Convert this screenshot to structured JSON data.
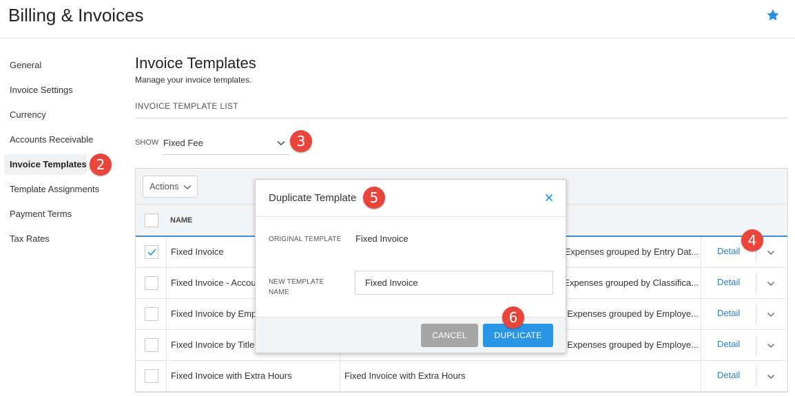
{
  "app": {
    "title": "Billing & Invoices"
  },
  "sidebar": {
    "items": [
      {
        "label": "General"
      },
      {
        "label": "Invoice Settings"
      },
      {
        "label": "Currency"
      },
      {
        "label": "Accounts Receivable"
      },
      {
        "label": "Invoice Templates",
        "active": true
      },
      {
        "label": "Template Assignments"
      },
      {
        "label": "Payment Terms"
      },
      {
        "label": "Tax Rates"
      }
    ]
  },
  "main": {
    "title": "Invoice Templates",
    "subtitle": "Manage your invoice templates.",
    "section_label": "INVOICE TEMPLATE LIST",
    "filter": {
      "label": "SHOW",
      "value": "Fixed Fee"
    },
    "actions_label": "Actions",
    "table": {
      "name_header": "NAME",
      "detail_label": "Detail",
      "rows": [
        {
          "name": "Fixed Invoice",
          "description": "Expenses grouped by Entry Dat...",
          "checked": true
        },
        {
          "name": "Fixed Invoice - Accou",
          "description": "Expenses grouped by Classifica...",
          "checked": false
        },
        {
          "name": "Fixed Invoice by Emp",
          "description": "Expenses grouped by Employe...",
          "checked": false
        },
        {
          "name": "Fixed Invoice by Title",
          "description": "Expenses grouped by Employe...",
          "checked": false
        },
        {
          "name": "Fixed Invoice with Extra Hours",
          "description": "Fixed Invoice with Extra Hours",
          "checked": false
        }
      ]
    }
  },
  "modal": {
    "title": "Duplicate Template",
    "original_label": "ORIGINAL TEMPLATE",
    "original_value": "Fixed Invoice",
    "new_name_label_line1": "NEW TEMPLATE",
    "new_name_label_line2": "NAME",
    "new_name_value": "Fixed Invoice",
    "cancel_label": "CANCEL",
    "duplicate_label": "DUPLICATE"
  },
  "callouts": [
    "2",
    "3",
    "4",
    "5",
    "6"
  ],
  "colors": {
    "accent": "#2b95e6",
    "link": "#2b7fc4",
    "callout": "#e8463c",
    "cancel": "#a5a5a5"
  },
  "icons": [
    "star-icon",
    "chevron-down-icon",
    "checkmark-icon",
    "close-icon"
  ]
}
